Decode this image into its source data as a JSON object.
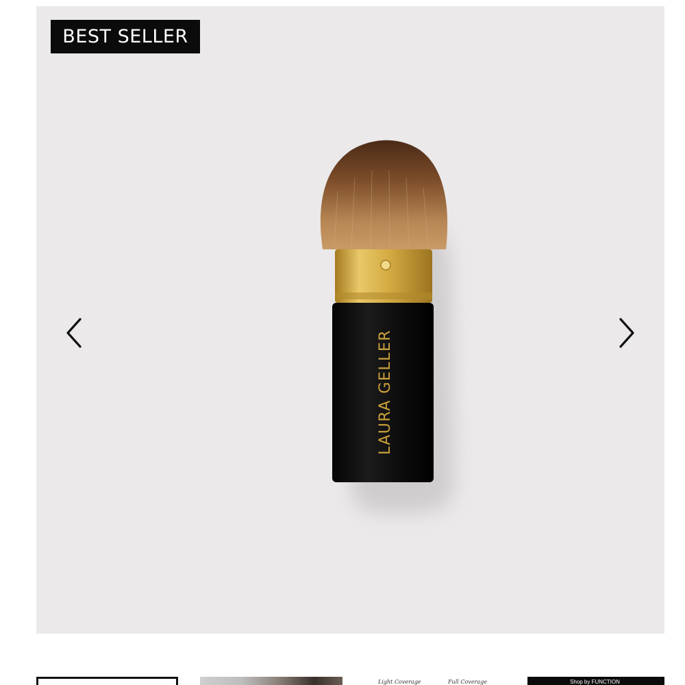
{
  "badge": {
    "label": "BEST SELLER"
  },
  "product": {
    "brand_imprint": "LAURA GELLER"
  },
  "carousel": {
    "prev_icon": "chevron-left-icon",
    "next_icon": "chevron-right-icon"
  },
  "thumbnails": {
    "thumb_3_left_text": "Light Coverage",
    "thumb_3_right_text": "Full Coverage",
    "thumb_4_text": "Shop by FUNCTION"
  },
  "colors": {
    "image_bg": "#ebe9ea",
    "badge_bg": "#0b0b0b",
    "handle": "#0d0d0d",
    "ferrule_gold": "#d9b24a",
    "imprint_gold": "#c9a13a",
    "bristles": "#8a5a32"
  }
}
